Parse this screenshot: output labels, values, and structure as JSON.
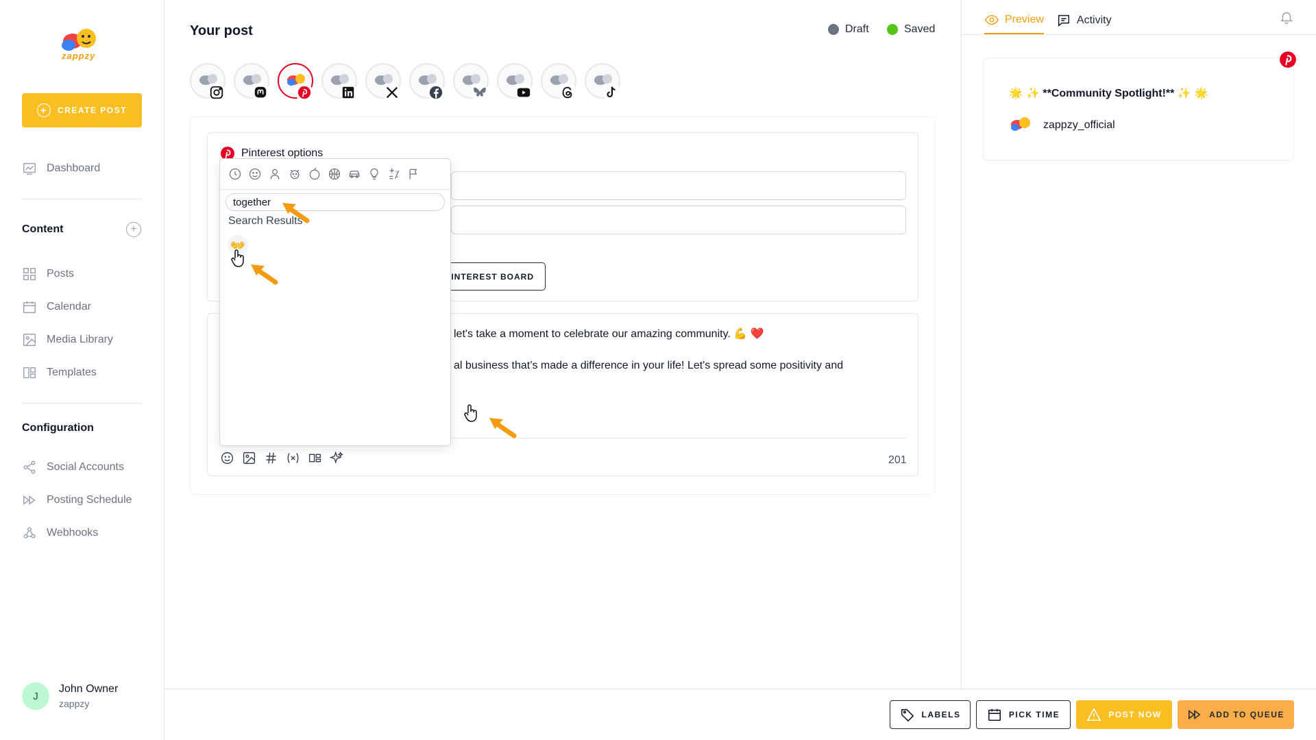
{
  "app": {
    "logo_text": "zappzy"
  },
  "sidebar": {
    "create_label": "CREATE POST",
    "dashboard": "Dashboard",
    "content_title": "Content",
    "content_items": [
      "Posts",
      "Calendar",
      "Media Library",
      "Templates"
    ],
    "config_title": "Configuration",
    "config_items": [
      "Social Accounts",
      "Posting Schedule",
      "Webhooks"
    ],
    "user": {
      "initial": "J",
      "name": "John Owner",
      "org": "zappzy"
    }
  },
  "main": {
    "title": "Your post",
    "status": [
      {
        "label": "Draft",
        "color": "#6b7280"
      },
      {
        "label": "Saved",
        "color": "#52c41a"
      }
    ],
    "channels": [
      "instagram",
      "mastodon",
      "pinterest",
      "linkedin",
      "x",
      "facebook",
      "bluesky",
      "youtube",
      "threads",
      "tiktok"
    ],
    "active_channel": "pinterest",
    "options_title": "Pinterest options",
    "board_button": "INTEREST BOARD",
    "editor_lines": [
      "let's take a moment to celebrate our amazing community. 💪 ❤️",
      "al business that’s made a difference in your life! Let's spread some positivity and"
    ],
    "char_count": "201"
  },
  "emoji_picker": {
    "search_value": "together",
    "results_label": "Search Results",
    "result": "👐"
  },
  "preview": {
    "tab_preview": "Preview",
    "tab_activity": "Activity",
    "text_prefix": "🌟 ✨",
    "text_main": "**Community Spotlight!**",
    "text_suffix": "✨ 🌟",
    "username": "zappzy_official"
  },
  "actions": {
    "labels": "LABELS",
    "pick_time": "PICK TIME",
    "post_now": "POST NOW",
    "add_to_queue": "ADD TO QUEUE"
  },
  "colors": {
    "accent": "#fbbf24",
    "pinterest": "#e60023"
  }
}
